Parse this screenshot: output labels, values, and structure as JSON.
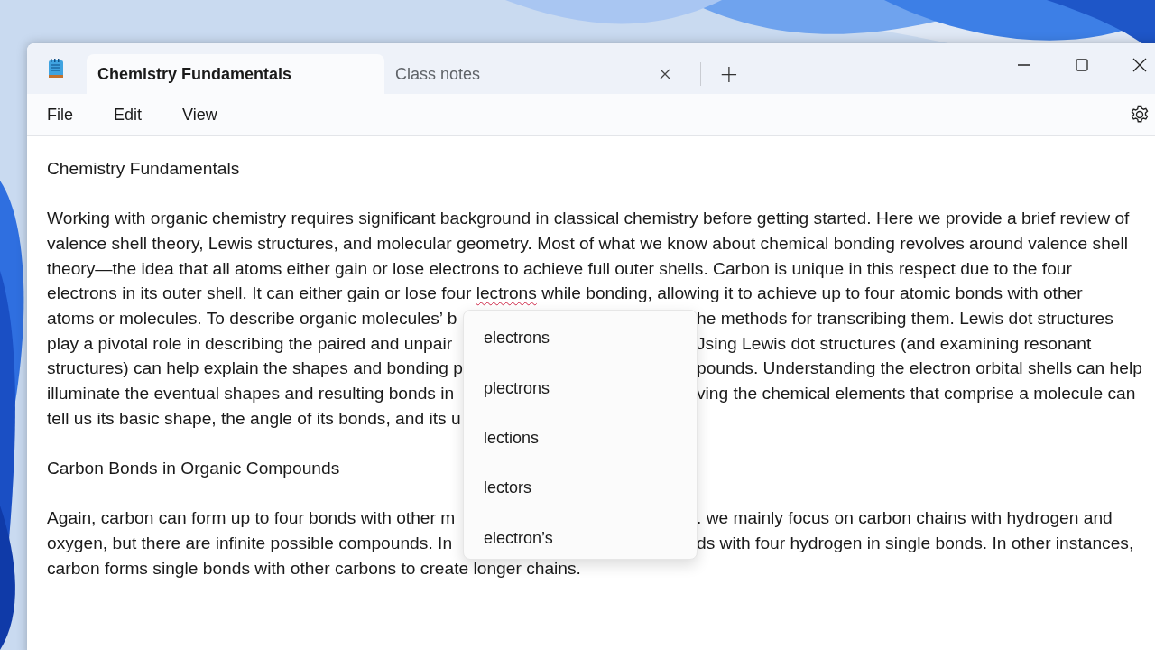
{
  "window": {
    "tabs": [
      {
        "label": "Chemistry Fundamentals",
        "selected": true,
        "close_button": false
      },
      {
        "label": "Class notes",
        "selected": false,
        "close_button": true
      }
    ],
    "new_tab": "+"
  },
  "menu": [
    "File",
    "Edit",
    "View"
  ],
  "document": {
    "lines": [
      {
        "kind": "text",
        "text": "Chemistry Fundamentals"
      },
      {
        "kind": "blank"
      },
      {
        "kind": "text",
        "text": "Working with organic chemistry requires significant background in classical chemistry before getting started. Here we provide a brief review of"
      },
      {
        "kind": "text",
        "text": "valence shell theory, Lewis structures, and molecular geometry. Most of what we know about chemical bonding revolves around valence shell"
      },
      {
        "kind": "text",
        "text": "theory—the idea that all atoms either gain or lose electrons to achieve full outer shells. Carbon is unique in this respect due to the four"
      },
      {
        "kind": "spelling",
        "before": "electrons in its outer shell. It can either gain or lose four ",
        "word": "lectrons",
        "after": " while bonding, allowing it to achieve up to four atomic bonds with other"
      },
      {
        "kind": "split",
        "left": "atoms or molecules. To describe organic molecules’ b",
        "right": "he methods for transcribing them. Lewis dot structures"
      },
      {
        "kind": "split",
        "left": "play a pivotal role in describing the paired and unpair",
        "right": "Jsing Lewis dot structures (and examining resonant"
      },
      {
        "kind": "split",
        "left": "structures) can help explain the shapes and bonding p",
        "right": "pounds. Understanding the electron orbital shells can help"
      },
      {
        "kind": "split",
        "left": "illuminate the eventual shapes and resulting bonds in",
        "right": "ving the chemical elements that comprise a molecule can"
      },
      {
        "kind": "split",
        "left": "tell us its basic shape, the angle of its bonds, and its u"
      },
      {
        "kind": "blank"
      },
      {
        "kind": "text",
        "text": "Carbon Bonds in Organic Compounds"
      },
      {
        "kind": "blank"
      },
      {
        "kind": "split",
        "left": "Again, carbon can form up to four bonds with other m",
        "right": ". we mainly focus on carbon chains with hydrogen and"
      },
      {
        "kind": "split",
        "left": "oxygen, but there are infinite possible compounds. In",
        "right": "ds with four hydrogen in single bonds. In other instances,"
      },
      {
        "kind": "text",
        "text": "carbon forms single bonds with other carbons to create longer chains."
      }
    ]
  },
  "suggestions": [
    "electrons",
    "plectrons",
    "lections",
    "lectors",
    "electron’s"
  ]
}
